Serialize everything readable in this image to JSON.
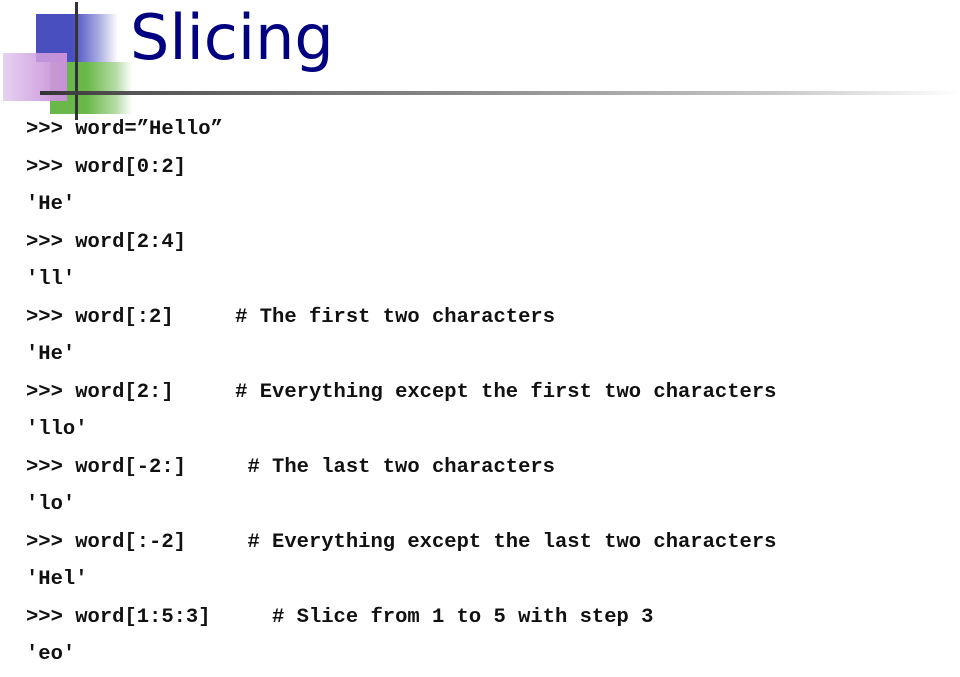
{
  "slide": {
    "title": "Slicing",
    "colors": {
      "title": "#000080",
      "deco_blue": "#4a4fc0",
      "deco_green": "#6ab84a",
      "deco_pink": "#c88fd8"
    },
    "lines": [
      {
        "type": "input",
        "prompt": ">>>",
        "code": "word=”Hello”",
        "comment": ""
      },
      {
        "type": "input",
        "prompt": ">>>",
        "code": "word[0:2]",
        "comment": ""
      },
      {
        "type": "output",
        "text": "'He'"
      },
      {
        "type": "input",
        "prompt": ">>>",
        "code": "word[2:4]",
        "comment": ""
      },
      {
        "type": "output",
        "text": "'ll'"
      },
      {
        "type": "input",
        "prompt": ">>>",
        "code": "word[:2]",
        "comment": "# The first two characters"
      },
      {
        "type": "output",
        "text": "'He'"
      },
      {
        "type": "input",
        "prompt": ">>>",
        "code": "word[2:]",
        "comment": "# Everything except the first two characters"
      },
      {
        "type": "output",
        "text": "'llo'"
      },
      {
        "type": "input",
        "prompt": ">>>",
        "code": "word[-2:]",
        "comment": "# The last two characters"
      },
      {
        "type": "output",
        "text": "'lo'"
      },
      {
        "type": "input",
        "prompt": ">>>",
        "code": "word[:-2]",
        "comment": "# Everything except the last two characters"
      },
      {
        "type": "output",
        "text": "'Hel'"
      },
      {
        "type": "input",
        "prompt": ">>>",
        "code": "word[1:5:3]",
        "comment": "# Slice from 1 to 5 with step 3"
      },
      {
        "type": "output",
        "text": "'eo'"
      }
    ]
  }
}
